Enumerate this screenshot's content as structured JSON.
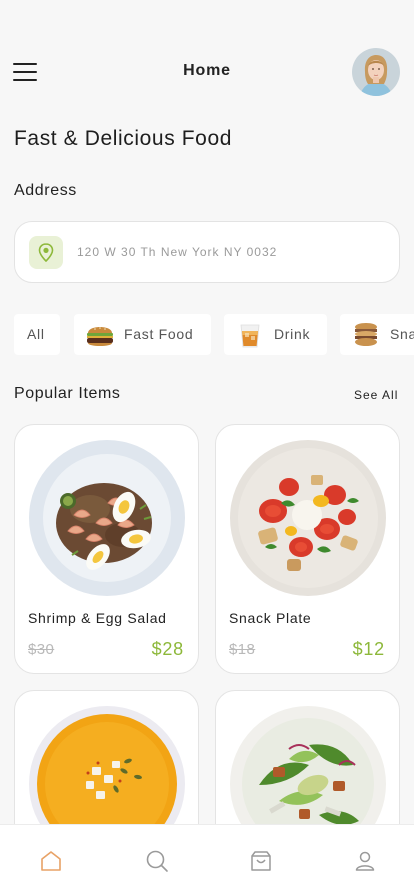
{
  "header": {
    "title": "Home",
    "menu_icon": "hamburger-menu-icon",
    "avatar_alt": "user avatar"
  },
  "page_title": "Fast & Delicious Food",
  "address": {
    "label": "Address",
    "value": "120 W 30 Th New York NY 0032",
    "icon": "location-pin-icon",
    "accent_bg": "#e9f1d6",
    "accent": "#8db83a"
  },
  "categories": [
    {
      "label": "All",
      "icon": ""
    },
    {
      "label": "Fast Food",
      "icon": "burger-icon"
    },
    {
      "label": "Drink",
      "icon": "drink-icon"
    },
    {
      "label": "Snacks",
      "icon": "sandwich-icon"
    }
  ],
  "popular": {
    "title": "Popular Items",
    "see_all": "See All",
    "items": [
      {
        "name": "Shrimp & Egg Salad",
        "old_price": "$30",
        "price": "$28"
      },
      {
        "name": "Snack Plate",
        "old_price": "$18",
        "price": "$12"
      },
      {
        "name": "",
        "old_price": "",
        "price": ""
      },
      {
        "name": "",
        "old_price": "",
        "price": ""
      }
    ]
  },
  "bottom_nav": [
    {
      "icon": "home-icon",
      "active": true
    },
    {
      "icon": "search-icon",
      "active": false
    },
    {
      "icon": "shopping-bag-icon",
      "active": false
    },
    {
      "icon": "profile-icon",
      "active": false
    }
  ],
  "colors": {
    "price": "#8db83a",
    "active_nav": "#e8a266",
    "inactive_nav": "#9a9a9a"
  }
}
